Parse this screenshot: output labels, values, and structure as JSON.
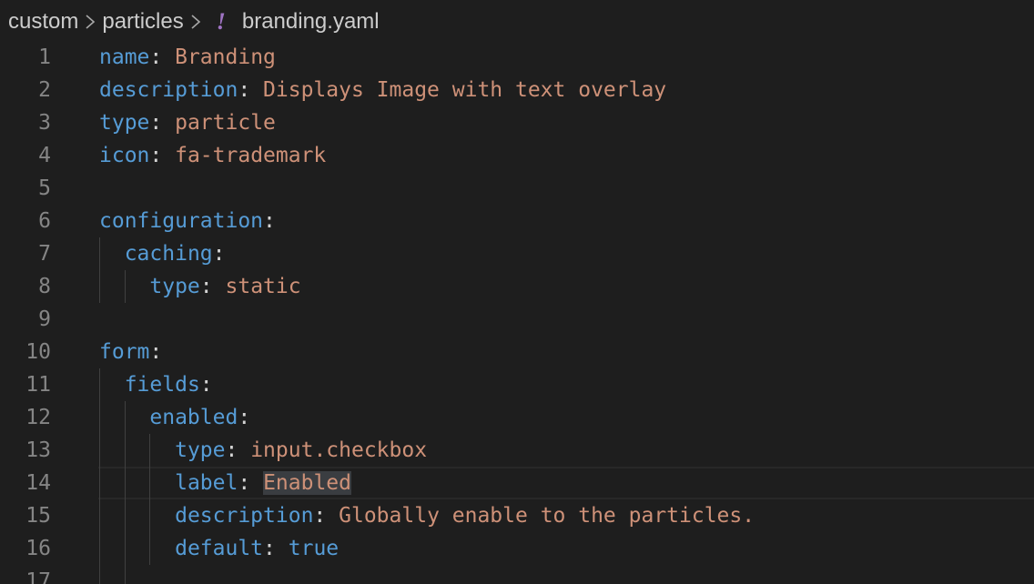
{
  "breadcrumb": {
    "folder1": "custom",
    "folder2": "particles",
    "file_icon_glyph": "!",
    "file_icon": "yaml-file-icon",
    "file": "branding.yaml"
  },
  "lines": [
    {
      "num": "1",
      "indent": "",
      "key": "name",
      "value": "Branding"
    },
    {
      "num": "2",
      "indent": "",
      "key": "description",
      "value": "Displays Image with text overlay"
    },
    {
      "num": "3",
      "indent": "",
      "key": "type",
      "value": "particle"
    },
    {
      "num": "4",
      "indent": "",
      "key": "icon",
      "value": "fa-trademark"
    },
    {
      "num": "5",
      "indent": "",
      "key": "",
      "value": ""
    },
    {
      "num": "6",
      "indent": "",
      "key": "configuration",
      "value": ""
    },
    {
      "num": "7",
      "indent": "  ",
      "key": "caching",
      "value": ""
    },
    {
      "num": "8",
      "indent": "    ",
      "key": "type",
      "value": "static"
    },
    {
      "num": "9",
      "indent": "",
      "key": "",
      "value": ""
    },
    {
      "num": "10",
      "indent": "",
      "key": "form",
      "value": ""
    },
    {
      "num": "11",
      "indent": "  ",
      "key": "fields",
      "value": ""
    },
    {
      "num": "12",
      "indent": "    ",
      "key": "enabled",
      "value": ""
    },
    {
      "num": "13",
      "indent": "      ",
      "key": "type",
      "value": "input.checkbox"
    },
    {
      "num": "14",
      "indent": "      ",
      "key": "label",
      "value": "Enabled"
    },
    {
      "num": "15",
      "indent": "      ",
      "key": "description",
      "value": "Globally enable to the particles."
    },
    {
      "num": "16",
      "indent": "      ",
      "key": "default",
      "value": "true"
    },
    {
      "num": "17",
      "indent": "",
      "key": "",
      "value": ""
    }
  ],
  "colors": {
    "background": "#1e1e1e",
    "key": "#569cd6",
    "string": "#ce9178",
    "line_number": "#858585",
    "yaml_icon": "#a074c4"
  }
}
